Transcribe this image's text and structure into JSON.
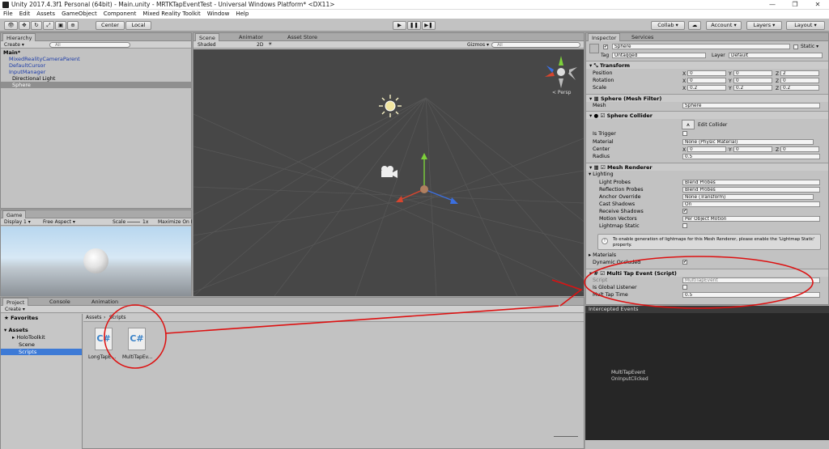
{
  "window": {
    "title": "Unity 2017.4.3f1 Personal (64bit) - Main.unity - MRTKTapEventTest - Universal Windows Platform* <DX11>",
    "minimize": "—",
    "maximize": "❐",
    "close": "✕"
  },
  "menu": [
    "File",
    "Edit",
    "Assets",
    "GameObject",
    "Component",
    "Mixed Reality Toolkit",
    "Window",
    "Help"
  ],
  "toolbar": {
    "center": "Center",
    "local": "Local",
    "collab": "Collab ▾",
    "account": "Account ▾",
    "layers": "Layers ▾",
    "layout": "Layout ▾",
    "play": "▶",
    "pause": "❚❚",
    "step": "▶❚"
  },
  "hierarchy": {
    "tab": "Hierarchy",
    "create": "Create ▾",
    "search": "All",
    "scene": "Main*",
    "items": [
      "MixedRealityCameraParent",
      "DefaultCursor",
      "InputManager",
      "Directional Light",
      "Sphere"
    ]
  },
  "scene": {
    "tabs": [
      "Scene",
      "Animator",
      "Asset Store"
    ],
    "shaded": "Shaded",
    "mode2d": "2D",
    "gizmos": "Gizmos ▾",
    "search": "All",
    "persp": "< Persp"
  },
  "game": {
    "tab": "Game",
    "display": "Display 1 ▾",
    "aspect": "Free Aspect ▾",
    "scale_label": "Scale",
    "scale_value": "1x",
    "maximize": "Maximize On Pl"
  },
  "project": {
    "tabs": [
      "Project",
      "Console",
      "Animation"
    ],
    "create": "Create ▾",
    "favorites": "Favorites",
    "assets": "Assets",
    "folders": [
      "HoloToolkit",
      "Scene",
      "Scripts"
    ],
    "breadcrumb": [
      "Assets",
      "Scripts"
    ],
    "files": [
      "LongTapE...",
      "MultiTapEv..."
    ]
  },
  "inspector": {
    "tabs": [
      "Inspector",
      "Services"
    ],
    "object_name": "Sphere",
    "static": "Static ▾",
    "tag_label": "Tag",
    "tag": "Untagged",
    "layer_label": "Layer",
    "layer": "Default",
    "transform": {
      "title": "Transform",
      "rows": [
        {
          "label": "Position",
          "x": "0",
          "y": "0",
          "z": "2"
        },
        {
          "label": "Rotation",
          "x": "0",
          "y": "0",
          "z": "0"
        },
        {
          "label": "Scale",
          "x": "0.2",
          "y": "0.2",
          "z": "0.2"
        }
      ]
    },
    "mesh_filter": {
      "title": "Sphere (Mesh Filter)",
      "mesh_label": "Mesh",
      "mesh": "Sphere"
    },
    "collider": {
      "title": "Sphere Collider",
      "edit": "Edit Collider",
      "trigger": "Is Trigger",
      "material_label": "Material",
      "material": "None (Physic Material)",
      "center_label": "Center",
      "cx": "0",
      "cy": "0",
      "cz": "0",
      "radius_label": "Radius",
      "radius": "0.5"
    },
    "renderer": {
      "title": "Mesh Renderer",
      "lighting": "Lighting",
      "rows": [
        {
          "label": "Light Probes",
          "value": "Blend Probes"
        },
        {
          "label": "Reflection Probes",
          "value": "Blend Probes"
        },
        {
          "label": "Anchor Override",
          "value": "None (Transform)"
        },
        {
          "label": "Cast Shadows",
          "value": "On"
        },
        {
          "label": "Receive Shadows",
          "value": ""
        },
        {
          "label": "Motion Vectors",
          "value": "Per Object Motion"
        },
        {
          "label": "Lightmap Static",
          "value": ""
        }
      ],
      "info": "To enable generation of lightmaps for this Mesh Renderer, please enable the 'Lightmap Static' property.",
      "materials": "Materials",
      "dyn": "Dynamic Occluded"
    },
    "script": {
      "title": "Multi Tap Event (Script)",
      "script_label": "Script",
      "script": "MultiTapEvent",
      "global_label": "Is Global Listener",
      "time_label": "Mult Tap Time",
      "time": "0.5"
    }
  },
  "events": {
    "title": "Intercepted Events",
    "name": "MultiTapEvent",
    "handler": "OnInputClicked"
  },
  "colors": {
    "annotation": "#d11111",
    "scene_bg": "#474747",
    "selected": "#3d7ad6"
  }
}
